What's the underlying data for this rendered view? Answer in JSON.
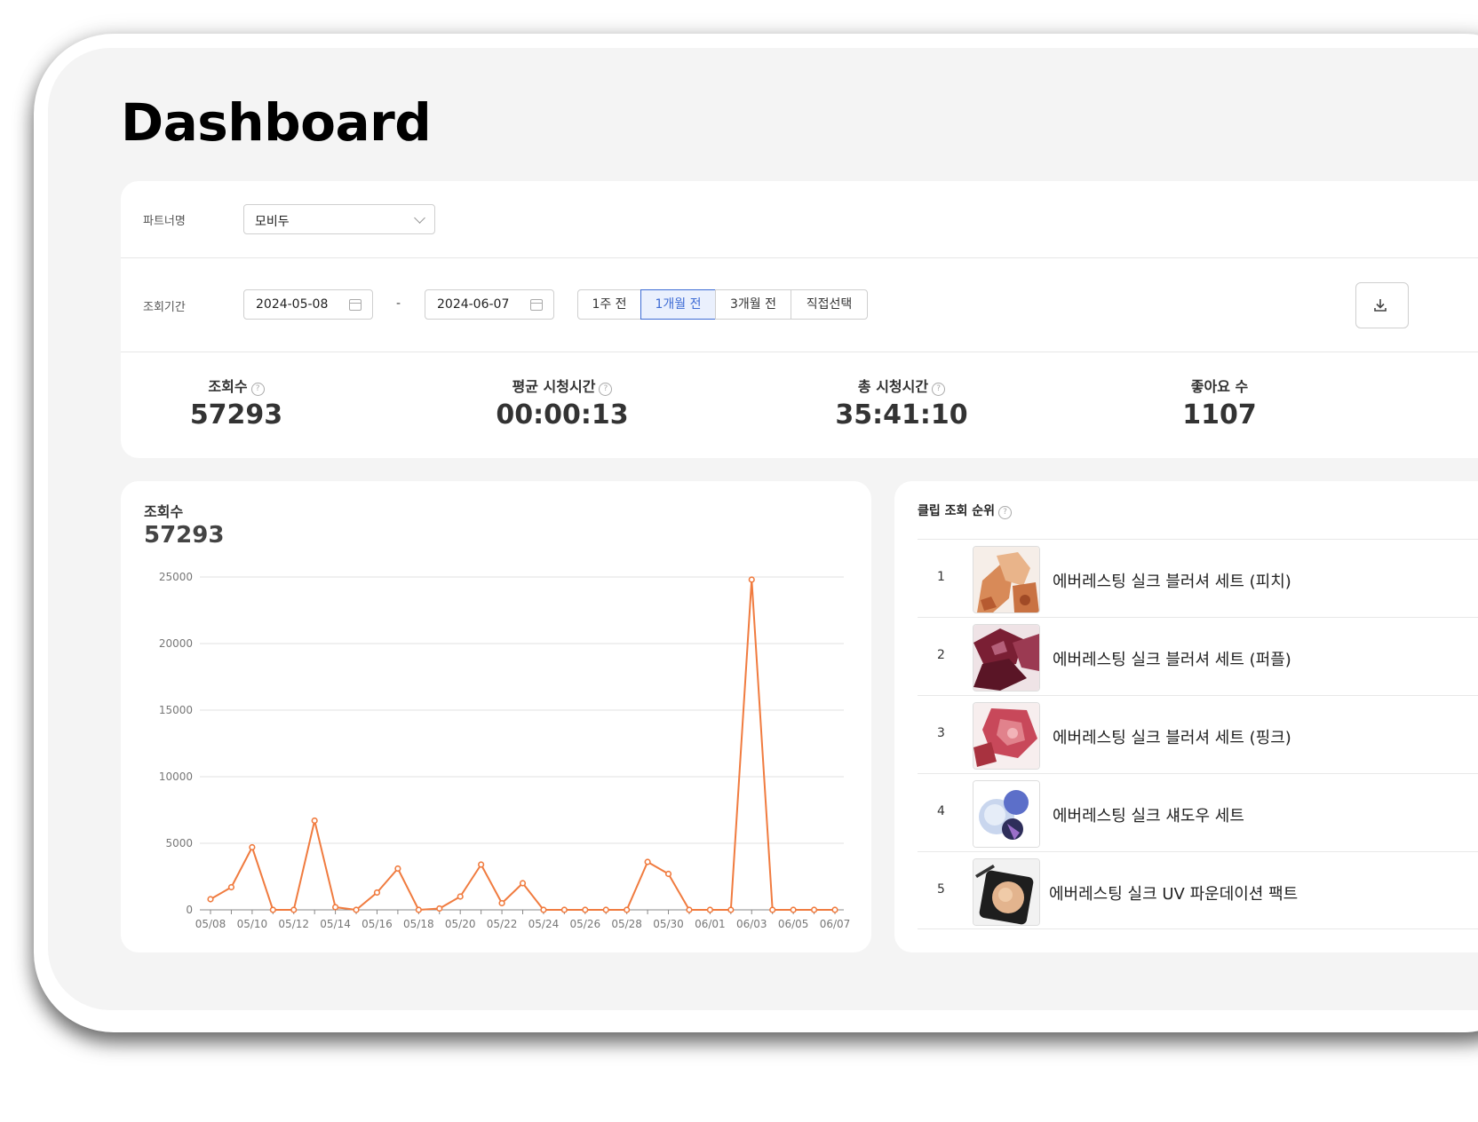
{
  "page": {
    "title": "Dashboard"
  },
  "filters": {
    "partner_label": "파트너명",
    "partner_value": "모비두",
    "period_label": "조회기간",
    "start_date": "2024-05-08",
    "date_separator": "-",
    "end_date": "2024-06-07",
    "ranges": [
      "1주 전",
      "1개월 전",
      "3개월 전",
      "직접선택"
    ],
    "active_range": "1개월 전"
  },
  "stats": [
    {
      "label": "조회수",
      "value": "57293",
      "help": true
    },
    {
      "label": "평균 시청시간",
      "value": "00:00:13",
      "help": true
    },
    {
      "label": "총 시청시간",
      "value": "35:41:10",
      "help": true
    },
    {
      "label": "좋아요 수",
      "value": "1107",
      "help": false
    }
  ],
  "views_chart": {
    "title": "조회수",
    "total": "57293",
    "accent": "#f07b3f"
  },
  "chart_data": {
    "type": "line",
    "title": "",
    "xlabel": "",
    "ylabel": "",
    "ylim": [
      0,
      25000
    ],
    "yticks": [
      0,
      5000,
      10000,
      15000,
      20000,
      25000
    ],
    "xticklabels": [
      "05/08",
      "05/10",
      "05/12",
      "05/14",
      "05/16",
      "05/18",
      "05/20",
      "05/22",
      "05/24",
      "05/26",
      "05/28",
      "05/30",
      "06/01",
      "06/03",
      "06/05",
      "06/07"
    ],
    "x": [
      "05/08",
      "05/09",
      "05/10",
      "05/11",
      "05/12",
      "05/13",
      "05/14",
      "05/15",
      "05/16",
      "05/17",
      "05/18",
      "05/19",
      "05/20",
      "05/21",
      "05/22",
      "05/23",
      "05/24",
      "05/25",
      "05/26",
      "05/27",
      "05/28",
      "05/29",
      "05/30",
      "05/31",
      "06/01",
      "06/02",
      "06/03",
      "06/04",
      "06/05",
      "06/06",
      "06/07"
    ],
    "series": [
      {
        "values": [
          800,
          1700,
          4700,
          0,
          0,
          6700,
          200,
          0,
          1300,
          3100,
          0,
          100,
          1000,
          3400,
          500,
          2000,
          0,
          0,
          0,
          0,
          0,
          3600,
          2700,
          0,
          0,
          0,
          24800,
          0,
          0,
          0,
          0
        ]
      }
    ],
    "grid": true,
    "legend": "none"
  },
  "ranking": {
    "title": "클립 조회 순위",
    "items": [
      {
        "rank": "1",
        "name": "에버레스팅 실크 블러셔 세트 (피치)",
        "thumb": "peach"
      },
      {
        "rank": "2",
        "name": "에버레스팅 실크 블러셔 세트 (퍼플)",
        "thumb": "purple"
      },
      {
        "rank": "3",
        "name": "에버레스팅 실크 블러셔 세트 (핑크)",
        "thumb": "pink"
      },
      {
        "rank": "4",
        "name": "에버레스팅 실크 섀도우 세트",
        "thumb": "shadow"
      },
      {
        "rank": "5",
        "name": "에버레스팅 실크 UV 파운데이션 팩트",
        "thumb": "pact"
      }
    ]
  },
  "icons": {
    "help": "help-circle-icon",
    "calendar": "calendar-icon",
    "dropdown": "chevron-down-icon",
    "download": "download-icon"
  }
}
